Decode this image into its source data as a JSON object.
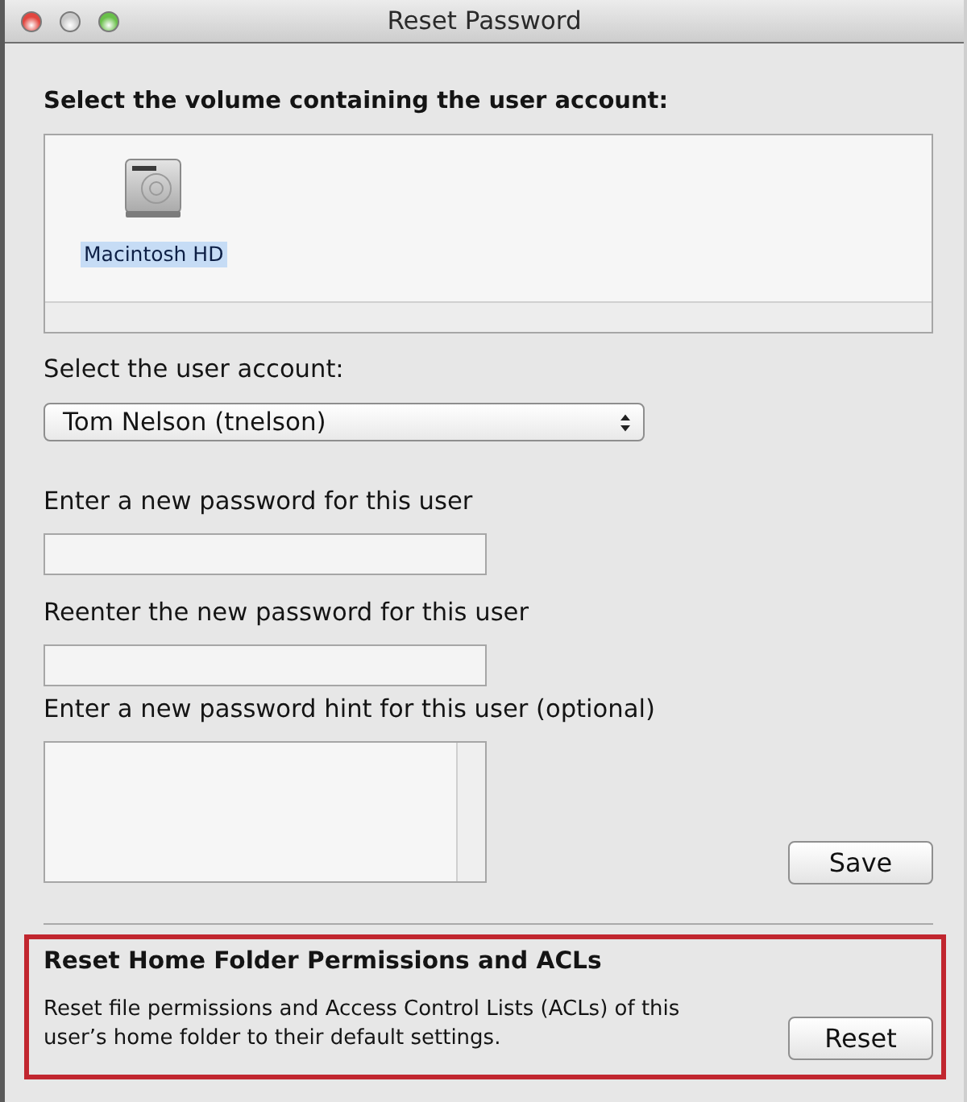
{
  "window": {
    "title": "Reset Password",
    "controls": [
      {
        "kind": "close",
        "disabled": false
      },
      {
        "kind": "minimize",
        "disabled": true
      },
      {
        "kind": "zoom",
        "disabled": false
      }
    ]
  },
  "volume_section": {
    "heading": "Select the volume containing the user account:",
    "volumes": [
      {
        "name": "Macintosh HD",
        "selected": true
      }
    ]
  },
  "account": {
    "label": "Select the user account:",
    "value": "Tom Nelson (tnelson)"
  },
  "fields": [
    {
      "label": "Enter a new password for this user",
      "kind": "password"
    },
    {
      "label": "Reenter the new password for this user",
      "kind": "password"
    },
    {
      "label": "Enter a new password hint for this user (optional)",
      "kind": "hint"
    }
  ],
  "save_button": "Save",
  "reset_section": {
    "highlighted": true,
    "title": "Reset Home Folder Permissions and ACLs",
    "description": "Reset file permissions and Access Control Lists (ACLs) of this user’s home folder to their default settings.",
    "button": "Reset"
  }
}
